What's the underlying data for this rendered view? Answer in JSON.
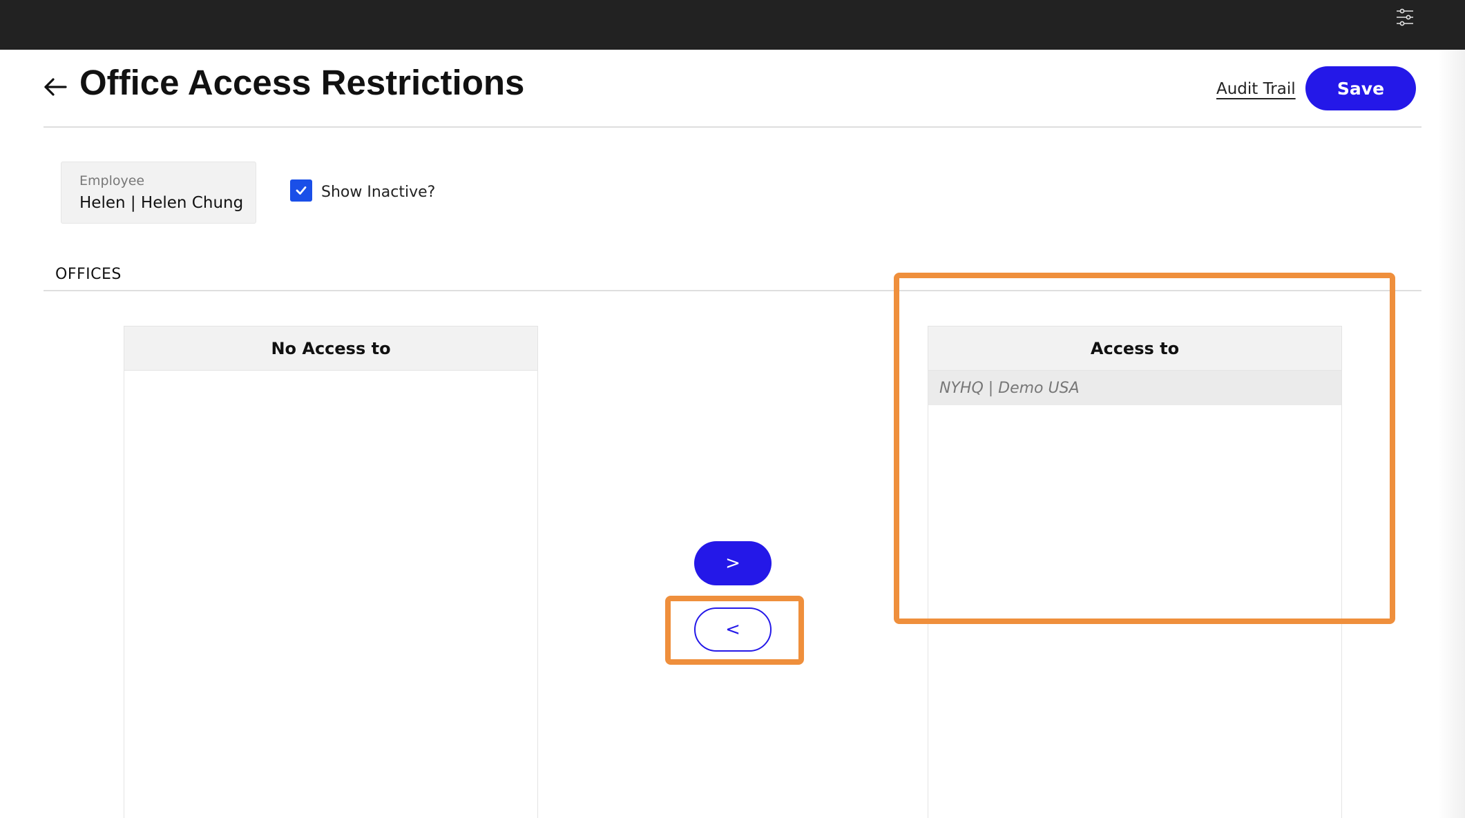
{
  "header": {
    "title": "Office Access Restrictions",
    "audit_trail_label": "Audit Trail",
    "save_label": "Save"
  },
  "employee": {
    "label": "Employee",
    "value": "Helen | Helen Chung"
  },
  "show_inactive": {
    "label": "Show Inactive?",
    "checked": true
  },
  "offices": {
    "heading": "OFFICES",
    "no_access": {
      "title": "No Access to",
      "items": []
    },
    "access": {
      "title": "Access to",
      "items": [
        "NYHQ | Demo USA"
      ]
    },
    "move_right_label": ">",
    "move_left_label": "<"
  },
  "colors": {
    "topbar": "#222222",
    "primary": "#2418e8",
    "checkbox": "#1a4fe8",
    "highlight": "#ef8f3c"
  },
  "icons": [
    "settings-sliders-icon",
    "arrow-left-icon",
    "checkmark-icon"
  ]
}
